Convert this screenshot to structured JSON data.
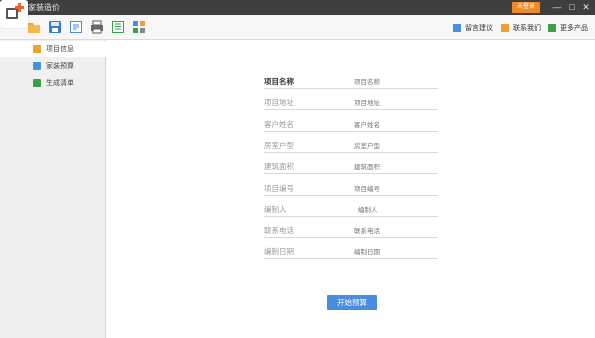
{
  "window": {
    "title": "家装造价"
  },
  "titlebar": {
    "login_label": "未登录",
    "minimize": "—",
    "maximize": "□",
    "close": "✕"
  },
  "toolbar": {
    "icons": [
      "folder-icon",
      "save-icon",
      "export-icon",
      "print-icon",
      "list-icon",
      "grid-icon"
    ],
    "links": [
      {
        "label": "留言建议",
        "icon": "message-icon",
        "color": "#4a90d9"
      },
      {
        "label": "联系我们",
        "icon": "mail-icon",
        "color": "#f0a030"
      },
      {
        "label": "更多产品",
        "icon": "bookmark-icon",
        "color": "#3aa04a"
      }
    ]
  },
  "sidebar": {
    "items": [
      {
        "label": "项目信息",
        "color": "#f0a030",
        "active": true
      },
      {
        "label": "家装预算",
        "color": "#4a90d9",
        "active": false
      },
      {
        "label": "生成清单",
        "color": "#3aa04a",
        "active": false
      }
    ]
  },
  "form": {
    "fields": [
      {
        "label": "项目名称",
        "placeholder": "项目名称"
      },
      {
        "label": "项目地址",
        "placeholder": "项目地址"
      },
      {
        "label": "客户姓名",
        "placeholder": "客户姓名"
      },
      {
        "label": "房室户型",
        "placeholder": "房室户型"
      },
      {
        "label": "建筑面积",
        "placeholder": "建筑面积"
      },
      {
        "label": "项目编号",
        "placeholder": "项目编号"
      },
      {
        "label": "编制人",
        "placeholder": "编制人"
      },
      {
        "label": "联系电话",
        "placeholder": "联系电话"
      },
      {
        "label": "编制日期",
        "placeholder": "编制日期"
      }
    ],
    "start_button": "开始预算"
  }
}
